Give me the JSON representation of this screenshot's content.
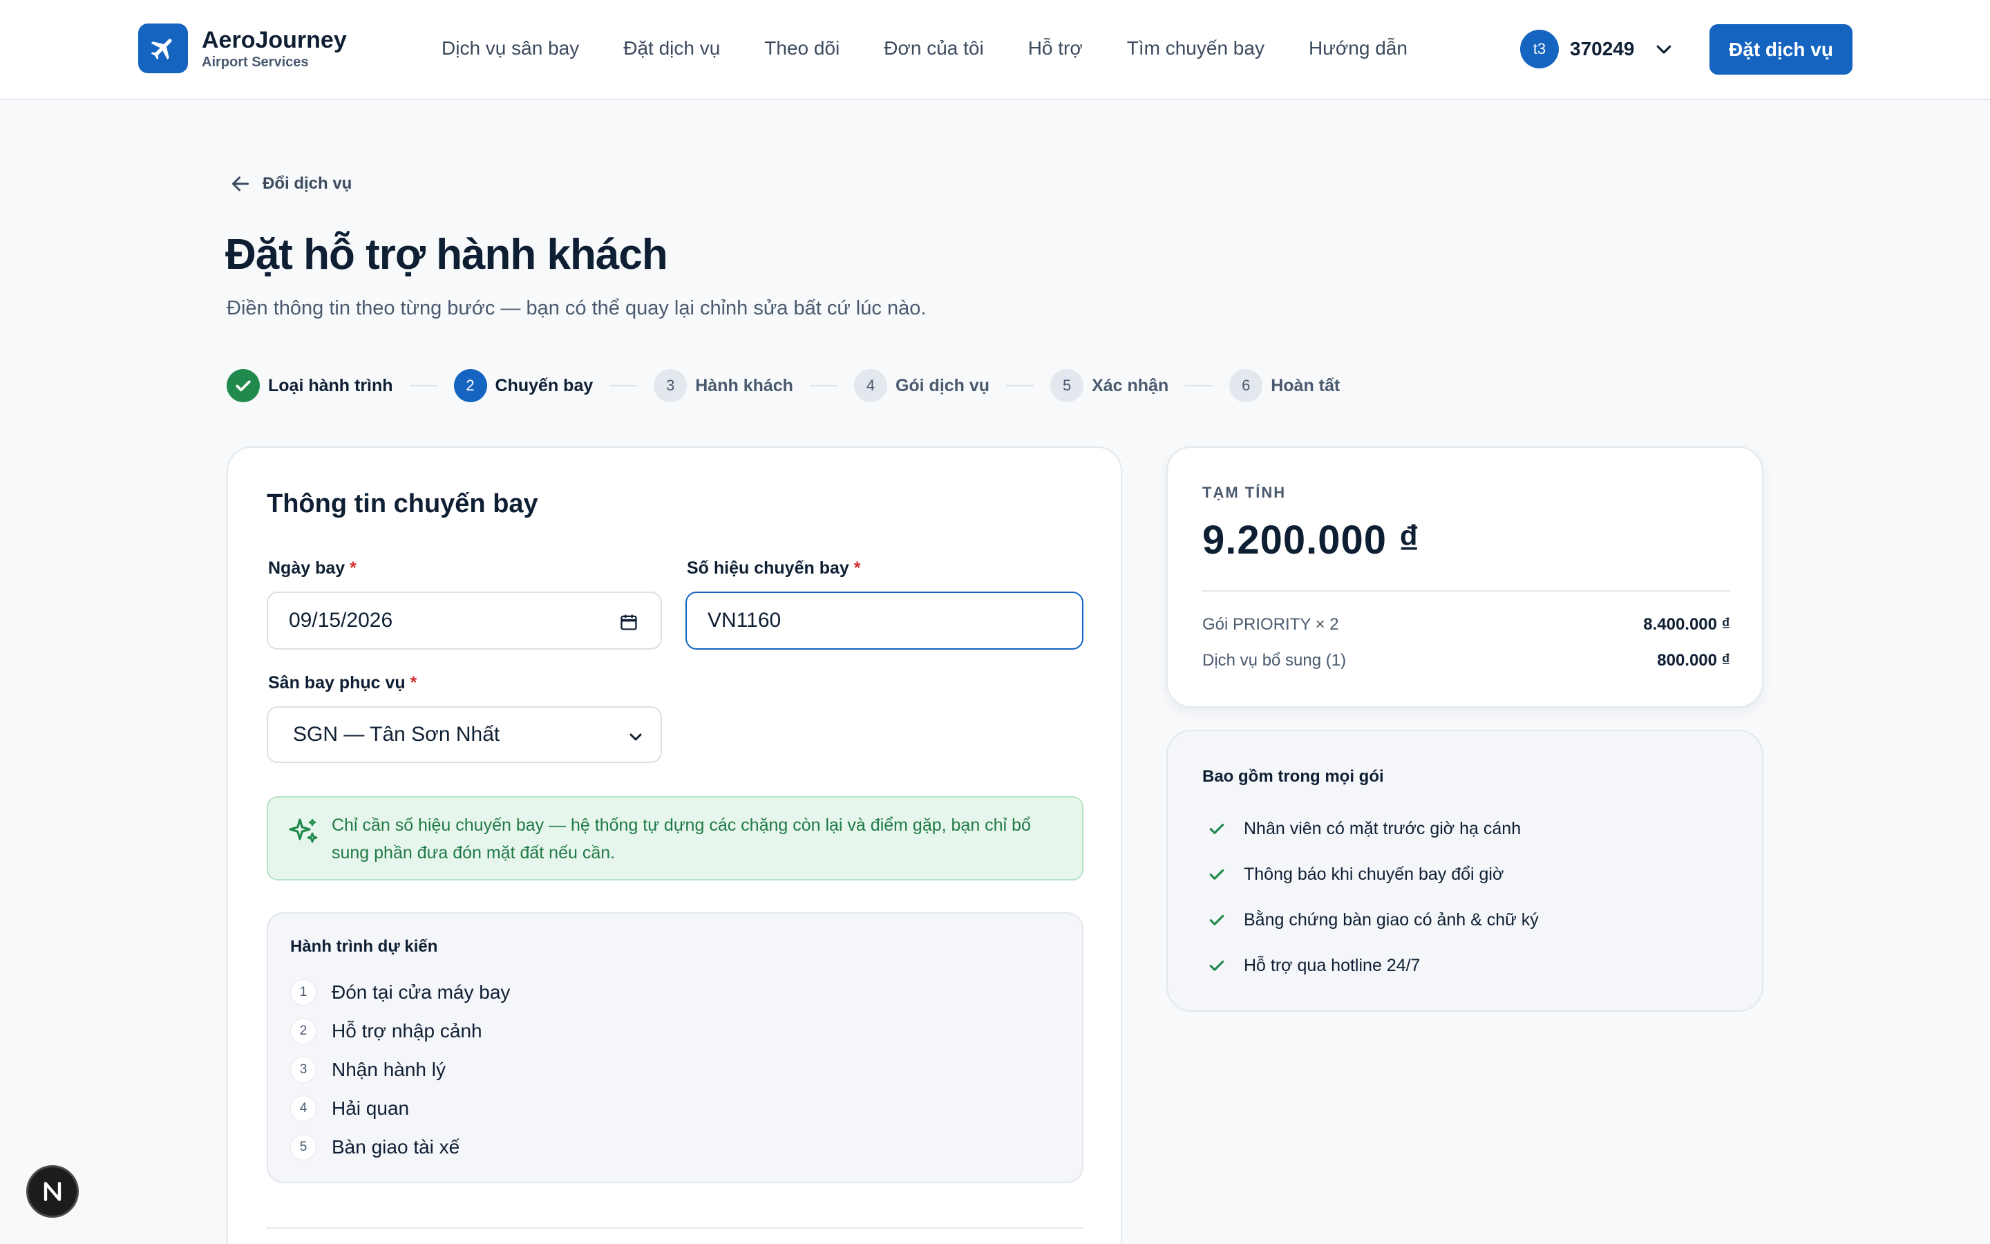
{
  "brand": {
    "name": "AeroJourney",
    "subtitle": "Airport Services"
  },
  "nav": {
    "items": [
      {
        "label": "Dịch vụ sân bay"
      },
      {
        "label": "Đặt dịch vụ"
      },
      {
        "label": "Theo dõi"
      },
      {
        "label": "Đơn của tôi"
      },
      {
        "label": "Hỗ trợ"
      },
      {
        "label": "Tìm chuyến bay"
      },
      {
        "label": "Hướng dẫn"
      }
    ]
  },
  "user": {
    "initials": "t3",
    "name": "370249"
  },
  "header_cta": {
    "label": "Đặt dịch vụ"
  },
  "back": {
    "label": "Đổi dịch vụ"
  },
  "page": {
    "title": "Đặt hỗ trợ hành khách",
    "subtitle": "Điền thông tin theo từng bước — bạn có thể quay lại chỉnh sửa bất cứ lúc nào."
  },
  "stepper": {
    "steps": [
      {
        "num": "1",
        "label": "Loại hành trình",
        "state": "done"
      },
      {
        "num": "2",
        "label": "Chuyến bay",
        "state": "active"
      },
      {
        "num": "3",
        "label": "Hành khách",
        "state": "pending"
      },
      {
        "num": "4",
        "label": "Gói dịch vụ",
        "state": "pending"
      },
      {
        "num": "5",
        "label": "Xác nhận",
        "state": "pending"
      },
      {
        "num": "6",
        "label": "Hoàn tất",
        "state": "pending"
      }
    ]
  },
  "form": {
    "title": "Thông tin chuyến bay",
    "date_label": "Ngày bay",
    "date_value": "09/15/2026",
    "flight_label": "Số hiệu chuyến bay",
    "flight_value": "VN1160",
    "airport_label": "Sân bay phục vụ",
    "airport_value": "SGN — Tân Sơn Nhất",
    "required_mark": "*",
    "hint": "Chỉ cần số hiệu chuyến bay — hệ thống tự dựng các chặng còn lại và điểm gặp, bạn chỉ bổ sung phần đưa đón mặt đất nếu cần."
  },
  "journey": {
    "title": "Hành trình dự kiến",
    "items": [
      {
        "num": "1",
        "label": "Đón tại cửa máy bay"
      },
      {
        "num": "2",
        "label": "Hỗ trợ nhập cảnh"
      },
      {
        "num": "3",
        "label": "Nhận hành lý"
      },
      {
        "num": "4",
        "label": "Hải quan"
      },
      {
        "num": "5",
        "label": "Bàn giao tài xế"
      }
    ]
  },
  "summary": {
    "label": "TẠM TÍNH",
    "total": "9.200.000 ₫",
    "rows": [
      {
        "label": "Gói PRIORITY × 2",
        "amount": "8.400.000 ₫"
      },
      {
        "label": "Dịch vụ bổ sung (1)",
        "amount": "800.000 ₫"
      }
    ]
  },
  "included": {
    "title": "Bao gồm trong mọi gói",
    "items": [
      {
        "label": "Nhân viên có mặt trước giờ hạ cánh"
      },
      {
        "label": "Thông báo khi chuyến bay đổi giờ"
      },
      {
        "label": "Bằng chứng bàn giao có ảnh & chữ ký"
      },
      {
        "label": "Hỗ trợ qua hotline 24/7"
      }
    ]
  },
  "colors": {
    "primary": "#1565c0",
    "success": "#1f8a4c",
    "required": "#d32f2f"
  },
  "icons": [
    "plane-icon",
    "chevron-down-icon",
    "arrow-left-icon",
    "check-icon",
    "calendar-icon",
    "sparkle-icon",
    "nextjs-icon"
  ]
}
